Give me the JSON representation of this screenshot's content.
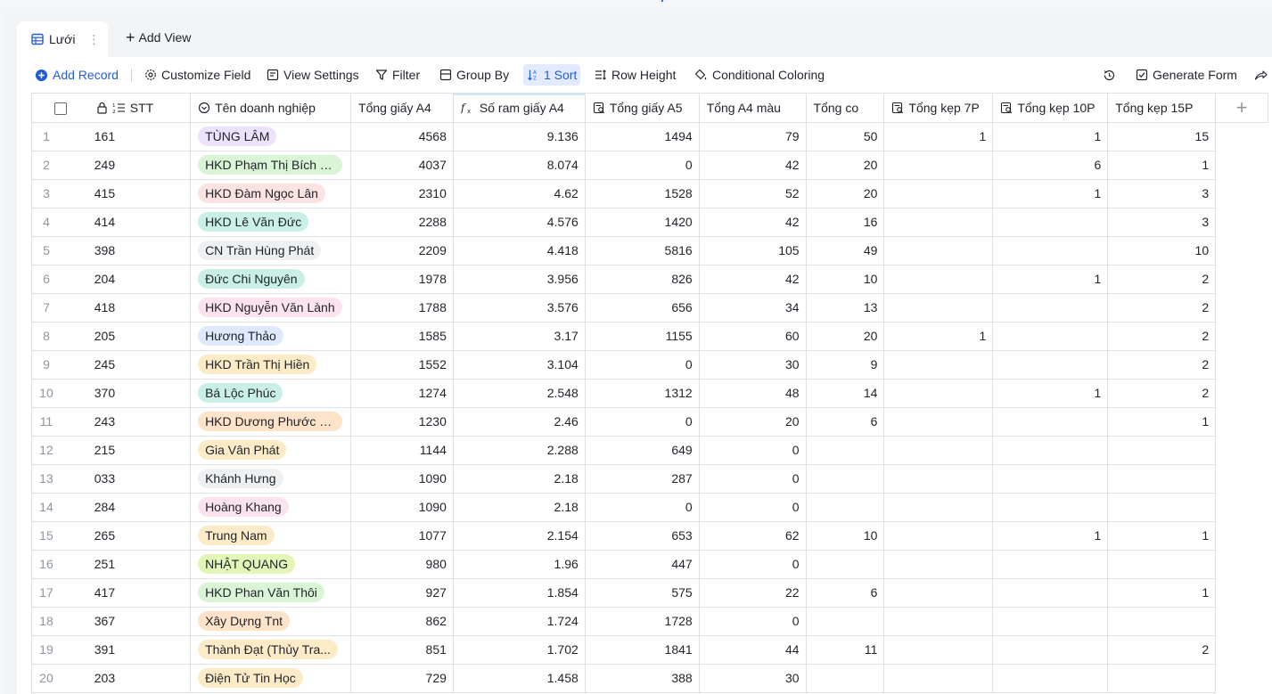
{
  "tabs": {
    "active_label": "Lưới",
    "add_view_label": "Add View"
  },
  "toolbar": {
    "add_record": "Add Record",
    "customize_field": "Customize Field",
    "view_settings": "View Settings",
    "filter": "Filter",
    "group_by": "Group By",
    "sort": "1 Sort",
    "row_height": "Row Height",
    "conditional_coloring": "Conditional Coloring",
    "generate_form": "Generate Form"
  },
  "colors": {
    "accent": "#245bdb",
    "sort_active_bg": "#e1eaff",
    "grid_border": "#dee0e3"
  },
  "columns": {
    "stt": "STT",
    "name": "Tên doanh nghiệp",
    "a4": "Tổng giấy A4",
    "ram": "Số ram giấy A4",
    "a5": "Tổng giấy A5",
    "a4color": "Tổng A4 màu",
    "co": "Tổng co",
    "kep7": "Tổng kẹp 7P",
    "kep10": "Tổng kẹp 10P",
    "kep15": "Tổng kẹp 15P"
  },
  "rows": [
    {
      "n": "1",
      "stt": "161",
      "name": "TÙNG LÂM",
      "tag": "#ece2fe",
      "a4": "4568",
      "ram": "9.136",
      "a5": "1494",
      "a4c": "79",
      "co": "50",
      "k7": "1",
      "k10": "1",
      "k15": "15"
    },
    {
      "n": "2",
      "stt": "249",
      "name": "HKD Phạm Thị Bích T...",
      "tag": "#d9f5d6",
      "a4": "4037",
      "ram": "8.074",
      "a5": "0",
      "a4c": "42",
      "co": "20",
      "k7": "",
      "k10": "6",
      "k15": "1"
    },
    {
      "n": "3",
      "stt": "415",
      "name": "HKD Đàm Ngọc Lân",
      "tag": "#fde2e2",
      "a4": "2310",
      "ram": "4.62",
      "a5": "1528",
      "a4c": "52",
      "co": "20",
      "k7": "",
      "k10": "1",
      "k15": "3"
    },
    {
      "n": "4",
      "stt": "414",
      "name": "HKD Lê Văn Đức",
      "tag": "#c9efe7",
      "a4": "2288",
      "ram": "4.576",
      "a5": "1420",
      "a4c": "42",
      "co": "16",
      "k7": "",
      "k10": "",
      "k15": "3"
    },
    {
      "n": "5",
      "stt": "398",
      "name": "CN Trần Hùng Phát",
      "tag": "#eff0f1",
      "a4": "2209",
      "ram": "4.418",
      "a5": "5816",
      "a4c": "105",
      "co": "49",
      "k7": "",
      "k10": "",
      "k15": "10"
    },
    {
      "n": "6",
      "stt": "204",
      "name": "Đức Chi Nguyên",
      "tag": "#c9efe7",
      "a4": "1978",
      "ram": "3.956",
      "a5": "826",
      "a4c": "42",
      "co": "10",
      "k7": "",
      "k10": "1",
      "k15": "2"
    },
    {
      "n": "7",
      "stt": "418",
      "name": "HKD Nguyễn Văn Lành",
      "tag": "#fde2ef",
      "a4": "1788",
      "ram": "3.576",
      "a5": "656",
      "a4c": "34",
      "co": "13",
      "k7": "",
      "k10": "",
      "k15": "2"
    },
    {
      "n": "8",
      "stt": "205",
      "name": "Hương Thảo",
      "tag": "#dfe8fd",
      "a4": "1585",
      "ram": "3.17",
      "a5": "1155",
      "a4c": "60",
      "co": "20",
      "k7": "1",
      "k10": "",
      "k15": "2"
    },
    {
      "n": "9",
      "stt": "245",
      "name": "HKD Trần Thị Hiền",
      "tag": "#fdebc8",
      "a4": "1552",
      "ram": "3.104",
      "a5": "0",
      "a4c": "30",
      "co": "9",
      "k7": "",
      "k10": "",
      "k15": "2"
    },
    {
      "n": "10",
      "stt": "370",
      "name": "Bá Lộc Phúc",
      "tag": "#c9efe7",
      "a4": "1274",
      "ram": "2.548",
      "a5": "1312",
      "a4c": "48",
      "co": "14",
      "k7": "",
      "k10": "1",
      "k15": "2"
    },
    {
      "n": "11",
      "stt": "243",
      "name": "HKD Dương Phước Hải",
      "tag": "#fee3c8",
      "a4": "1230",
      "ram": "2.46",
      "a5": "0",
      "a4c": "20",
      "co": "6",
      "k7": "",
      "k10": "",
      "k15": "1"
    },
    {
      "n": "12",
      "stt": "215",
      "name": "Gia Vân Phát",
      "tag": "#fdebc8",
      "a4": "1144",
      "ram": "2.288",
      "a5": "649",
      "a4c": "0",
      "co": "",
      "k7": "",
      "k10": "",
      "k15": ""
    },
    {
      "n": "13",
      "stt": "033",
      "name": "Khánh Hưng",
      "tag": "#eff0f1",
      "a4": "1090",
      "ram": "2.18",
      "a5": "287",
      "a4c": "0",
      "co": "",
      "k7": "",
      "k10": "",
      "k15": ""
    },
    {
      "n": "14",
      "stt": "284",
      "name": "Hoàng Khang",
      "tag": "#fde2ef",
      "a4": "1090",
      "ram": "2.18",
      "a5": "0",
      "a4c": "0",
      "co": "",
      "k7": "",
      "k10": "",
      "k15": ""
    },
    {
      "n": "15",
      "stt": "265",
      "name": "Trung Nam",
      "tag": "#fdebc8",
      "a4": "1077",
      "ram": "2.154",
      "a5": "653",
      "a4c": "62",
      "co": "10",
      "k7": "",
      "k10": "1",
      "k15": "1"
    },
    {
      "n": "16",
      "stt": "251",
      "name": "NHẬT QUANG",
      "tag": "#e4f5b8",
      "a4": "980",
      "ram": "1.96",
      "a5": "447",
      "a4c": "0",
      "co": "",
      "k7": "",
      "k10": "",
      "k15": ""
    },
    {
      "n": "17",
      "stt": "417",
      "name": "HKD Phan Văn Thôi",
      "tag": "#d9f5d6",
      "a4": "927",
      "ram": "1.854",
      "a5": "575",
      "a4c": "22",
      "co": "6",
      "k7": "",
      "k10": "",
      "k15": "1"
    },
    {
      "n": "18",
      "stt": "367",
      "name": "Xây Dựng Tnt",
      "tag": "#fee3c8",
      "a4": "862",
      "ram": "1.724",
      "a5": "1728",
      "a4c": "0",
      "co": "",
      "k7": "",
      "k10": "",
      "k15": ""
    },
    {
      "n": "19",
      "stt": "391",
      "name": "Thành Đạt (Thủy Tra...",
      "tag": "#fdebc8",
      "a4": "851",
      "ram": "1.702",
      "a5": "1841",
      "a4c": "44",
      "co": "11",
      "k7": "",
      "k10": "",
      "k15": "2"
    },
    {
      "n": "20",
      "stt": "203",
      "name": "Điện Tử Tin Học",
      "tag": "#fdebc8",
      "a4": "729",
      "ram": "1.458",
      "a5": "388",
      "a4c": "30",
      "co": "",
      "k7": "",
      "k10": "",
      "k15": ""
    }
  ]
}
